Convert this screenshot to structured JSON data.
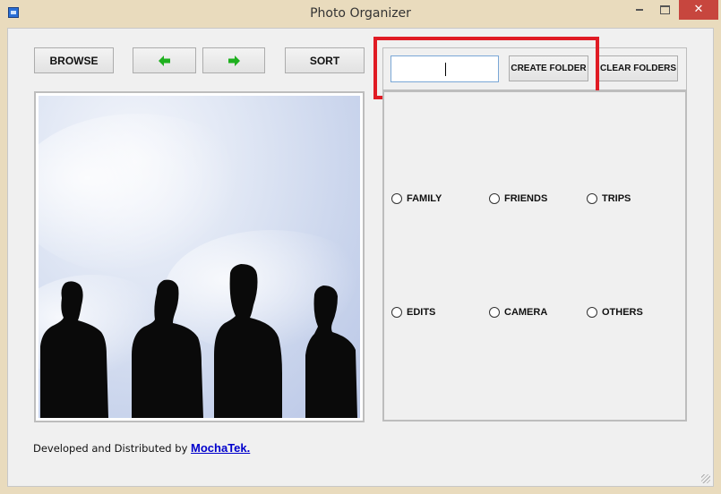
{
  "window": {
    "title": "Photo Organizer"
  },
  "toolbar": {
    "browse_label": "BROWSE",
    "prev_icon": "left-arrow-icon",
    "next_icon": "right-arrow-icon",
    "sort_label": "SORT"
  },
  "folder_input": {
    "value": "",
    "placeholder": ""
  },
  "folder_actions": {
    "create_label": "CREATE FOLDER",
    "clear_label": "CLEAR FOLDERS"
  },
  "folders": [
    {
      "label": "FAMILY"
    },
    {
      "label": "FRIENDS"
    },
    {
      "label": "TRIPS"
    },
    {
      "label": "EDITS"
    },
    {
      "label": "CAMERA"
    },
    {
      "label": "OTHERS"
    }
  ],
  "footer": {
    "text": "Developed and Distributed by",
    "link": "MochaTek."
  },
  "colors": {
    "arrow_green": "#1fb01f",
    "highlight_red": "#e01b24",
    "link_blue": "#0000cc"
  }
}
